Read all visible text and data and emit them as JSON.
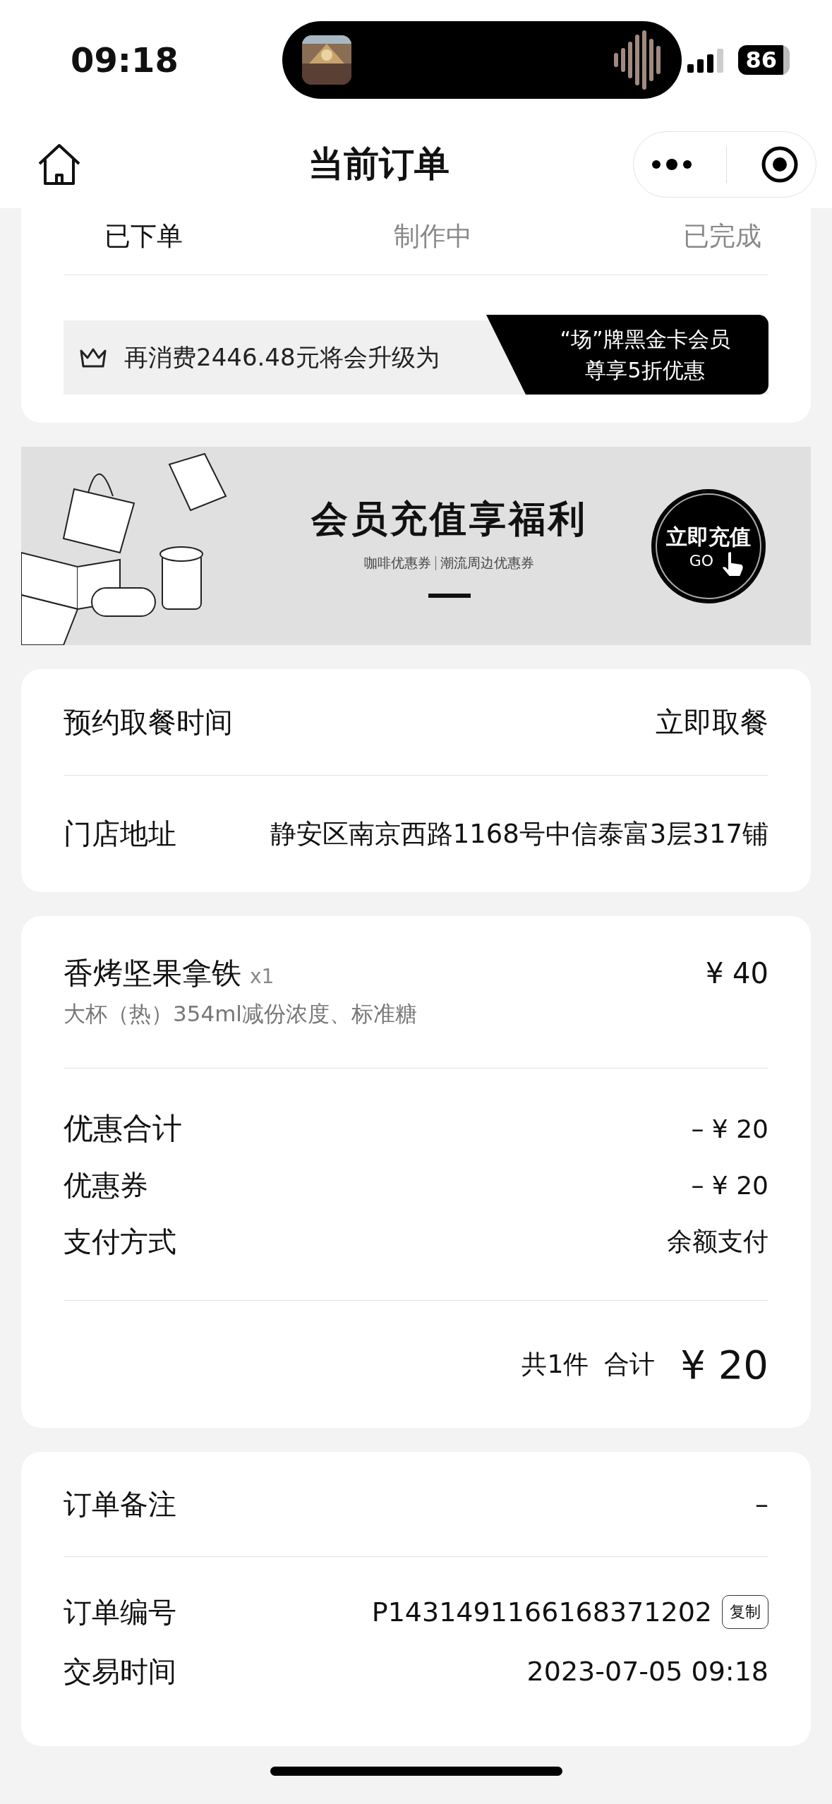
{
  "status_bar": {
    "time": "09:18",
    "battery": "86"
  },
  "nav": {
    "title": "当前订单"
  },
  "progress_tabs": [
    {
      "label": "已下单",
      "selected": true
    },
    {
      "label": "制作中",
      "selected": false
    },
    {
      "label": "已完成",
      "selected": false
    }
  ],
  "member_bar": {
    "text": "再消费2446.48元将会升级为",
    "tag_lines": [
      "“场”牌黑金卡会员",
      "尊享5折优惠"
    ]
  },
  "banner": {
    "title": "会员充值享福利",
    "subtitle_parts": [
      "咖啡优惠券",
      "潮流周边优惠券"
    ],
    "button_lines": [
      "立即充值",
      "GO"
    ]
  },
  "pickup_info": [
    {
      "label": "预约取餐时间",
      "value": "立即取餐"
    },
    {
      "label": "门店地址",
      "value": "静安区南京西路1168号中信泰富3层317铺"
    }
  ],
  "order_item": {
    "name": "香烤坚果拿铁",
    "qty": "x1",
    "price": "¥ 40",
    "options": "大杯（热）354ml减份浓度、标准糖"
  },
  "price_rows": [
    {
      "label": "优惠合计",
      "value": "– ¥ 20"
    },
    {
      "label": "优惠券",
      "value": "– ¥ 20"
    },
    {
      "label": "支付方式",
      "value": "余额支付"
    }
  ],
  "total": {
    "count": "共1件",
    "label": "合计",
    "amount": "¥ 20"
  },
  "note_row": {
    "label": "订单备注",
    "value": "–"
  },
  "order_rows": [
    {
      "label": "订单编号",
      "value": "P1431491166168371202",
      "action": "复制"
    },
    {
      "label": "交易时间",
      "value": "2023-07-05 09:18"
    }
  ]
}
